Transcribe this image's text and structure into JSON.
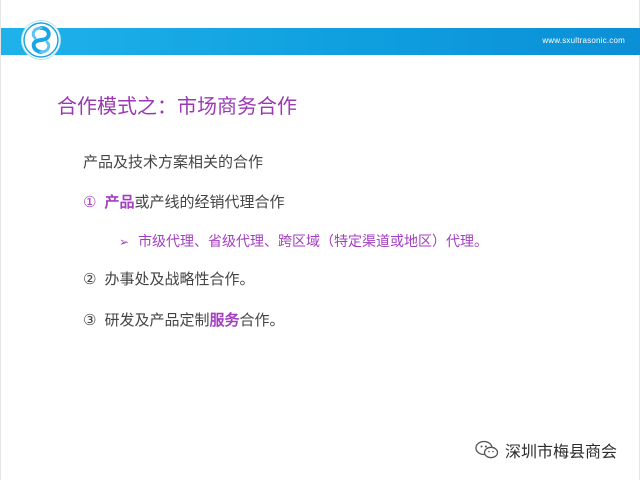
{
  "header": {
    "website": "www.sxultrasonic.com"
  },
  "colors": {
    "header_blue": "#0f9fdf",
    "accent_purple": "#a43ec0",
    "body_text": "#444444"
  },
  "slide": {
    "title": "合作模式之：市场商务合作",
    "heading": "产品及技术方案相关的合作",
    "item1": {
      "marker": "①",
      "highlight": "产品",
      "rest": "或产线的经销代理合作"
    },
    "sub_item": {
      "marker": "➢",
      "text": "市级代理、省级代理、跨区域（特定渠道或地区）代理。"
    },
    "item2": {
      "marker": "②",
      "text": "办事处及战略性合作。"
    },
    "item3": {
      "marker": "③",
      "before": "研发及产品定制",
      "highlight": "服务",
      "after": "合作。"
    }
  },
  "watermark": {
    "text": "深圳市梅县商会"
  }
}
